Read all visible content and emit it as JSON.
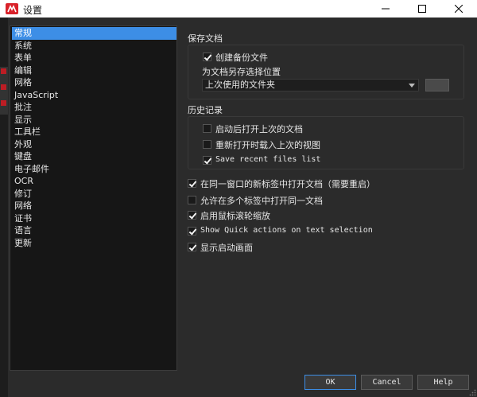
{
  "window": {
    "title": "设置"
  },
  "sidebar": {
    "items": [
      {
        "label": "常规",
        "selected": true
      },
      {
        "label": "系统"
      },
      {
        "label": "表单"
      },
      {
        "label": "编辑"
      },
      {
        "label": "网格"
      },
      {
        "label": "JavaScript"
      },
      {
        "label": "批注"
      },
      {
        "label": "显示"
      },
      {
        "label": "工具栏"
      },
      {
        "label": "外观"
      },
      {
        "label": "键盘"
      },
      {
        "label": "电子邮件"
      },
      {
        "label": "OCR"
      },
      {
        "label": "修订"
      },
      {
        "label": "网络"
      },
      {
        "label": "证书"
      },
      {
        "label": "语言"
      },
      {
        "label": "更新"
      }
    ]
  },
  "save_docs": {
    "title": "保存文档",
    "create_backup": {
      "label": "创建备份文件",
      "checked": true
    },
    "save_as_label": "为文档另存选择位置",
    "location_select": {
      "value": "上次使用的文件夹"
    }
  },
  "history": {
    "title": "历史记录",
    "reopen_last": {
      "label": "启动后打开上次的文档",
      "checked": false
    },
    "reload_view": {
      "label": "重新打开时载入上次的视图",
      "checked": false
    },
    "save_recent": {
      "label": "Save recent files list",
      "checked": true
    }
  },
  "options": [
    {
      "label": "在同一窗口的新标签中打开文档（需要重启）",
      "checked": true
    },
    {
      "label": "允许在多个标签中打开同一文档",
      "checked": false
    },
    {
      "label": "启用鼠标滚轮缩放",
      "checked": true
    },
    {
      "label": "Show Quick actions on text selection",
      "checked": true,
      "mono": true
    },
    {
      "label": "显示启动画面",
      "checked": true
    }
  ],
  "footer": {
    "ok": "OK",
    "cancel": "Cancel",
    "help": "Help"
  },
  "colors": {
    "accent": "#3d8ee6",
    "background": "#2b2b2b",
    "brand": "#d9222a"
  }
}
